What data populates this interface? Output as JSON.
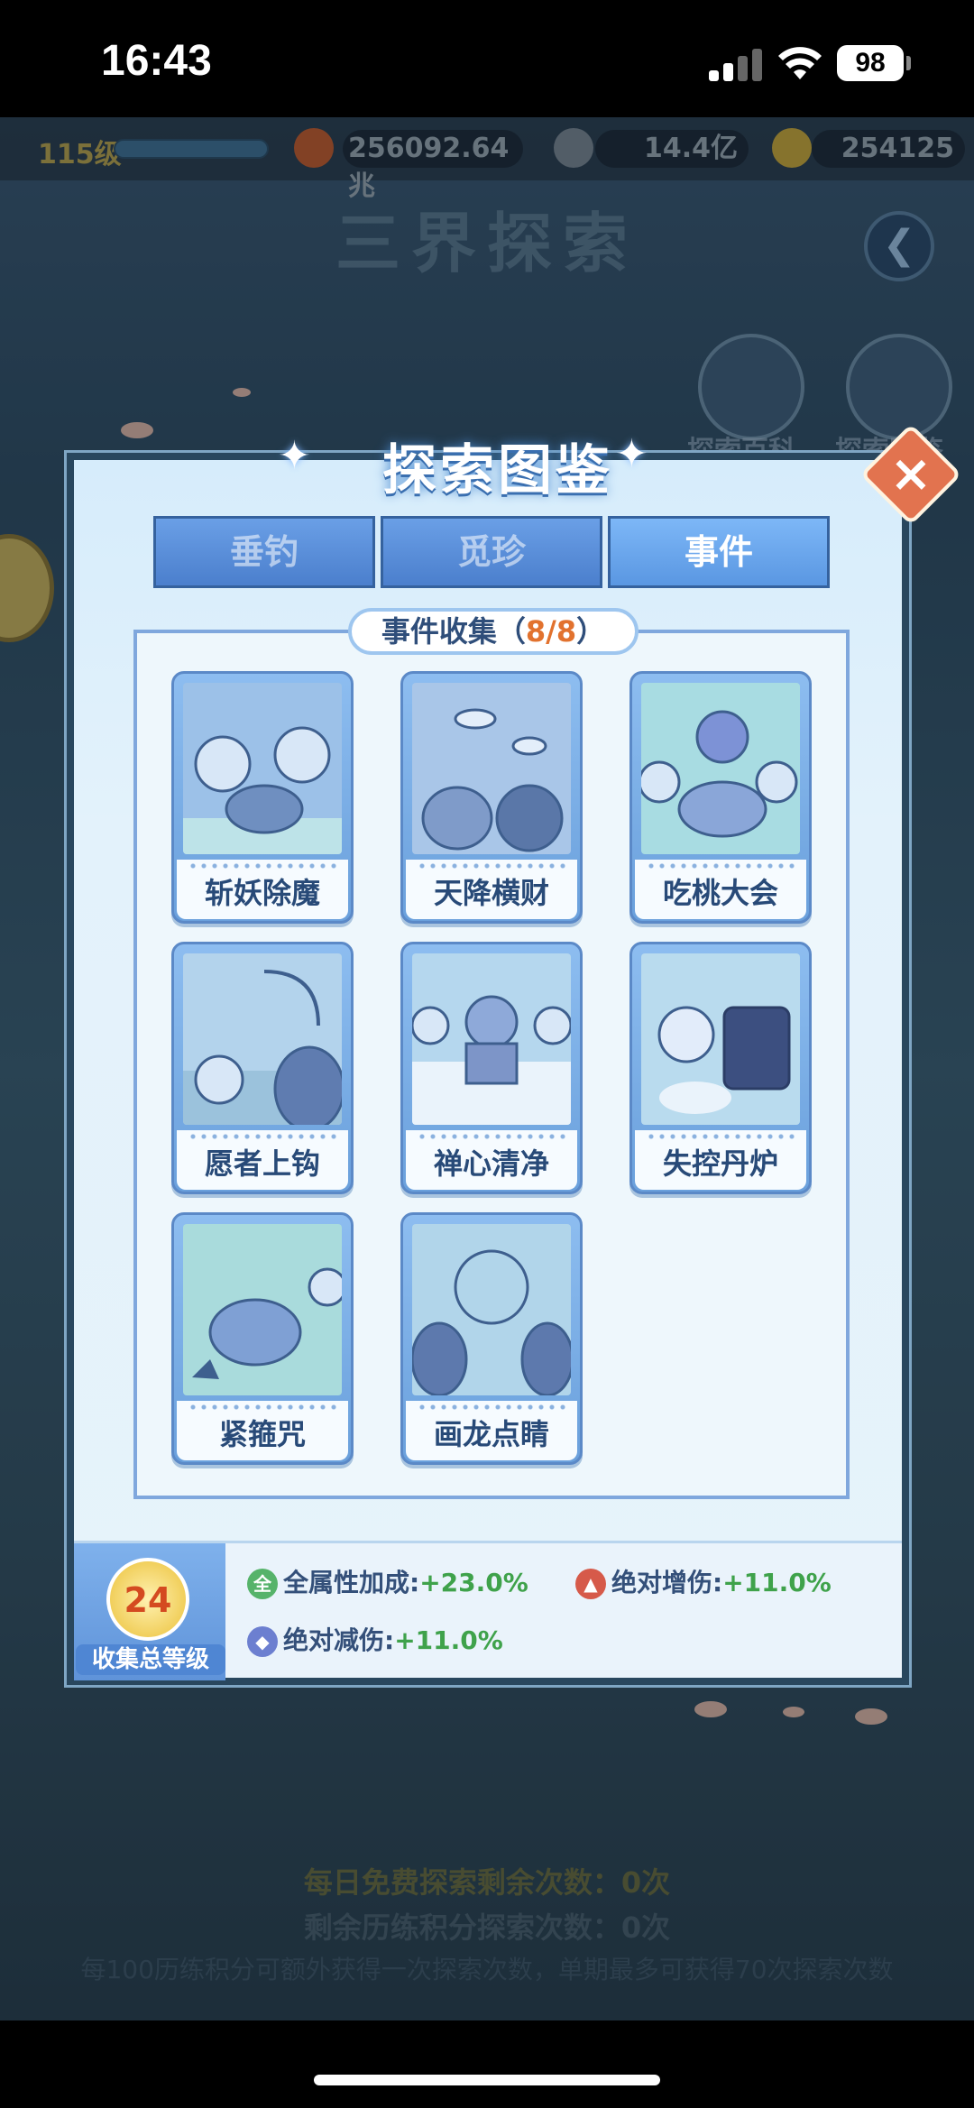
{
  "status_bar": {
    "time": "16:43",
    "battery": "98"
  },
  "top_bar": {
    "level": "115级",
    "power": "256092.64兆",
    "silver": "14.4亿",
    "gold": "254125"
  },
  "background": {
    "title": "三界探索",
    "side_buttons": [
      "探索百科",
      "探索图鉴"
    ],
    "daily_free": "每日免费探索剩余次数：0次",
    "remaining_points": "剩余历练积分探索次数：0次",
    "note": "每100历练积分可额外获得一次探索次数，单期最多可获得70次探索次数"
  },
  "modal": {
    "title": "探索图鉴",
    "tabs": [
      {
        "label": "垂钓",
        "active": false
      },
      {
        "label": "觅珍",
        "active": false
      },
      {
        "label": "事件",
        "active": true
      }
    ],
    "collection": {
      "label_prefix": "事件收集（",
      "count": "8/8",
      "label_suffix": "）"
    },
    "cards": [
      {
        "label": "斩妖除魔"
      },
      {
        "label": "天降横财"
      },
      {
        "label": "吃桃大会"
      },
      {
        "label": "愿者上钩"
      },
      {
        "label": "禅心清净"
      },
      {
        "label": "失控丹炉"
      },
      {
        "label": "紧箍咒"
      },
      {
        "label": "画龙点睛"
      }
    ],
    "collection_level": {
      "value": "24",
      "caption": "收集总等级"
    },
    "bonuses": [
      {
        "icon": "全",
        "label": "全属性加成:",
        "value": "+23.0%"
      },
      {
        "icon": "▲",
        "label": "绝对增伤:",
        "value": "+11.0%"
      },
      {
        "icon": "◆",
        "label": "绝对减伤:",
        "value": "+11.0%"
      }
    ]
  },
  "colors": {
    "accent": "#4b7fcd",
    "bonus_value": "#3fa24b",
    "close": "#e2734f"
  }
}
